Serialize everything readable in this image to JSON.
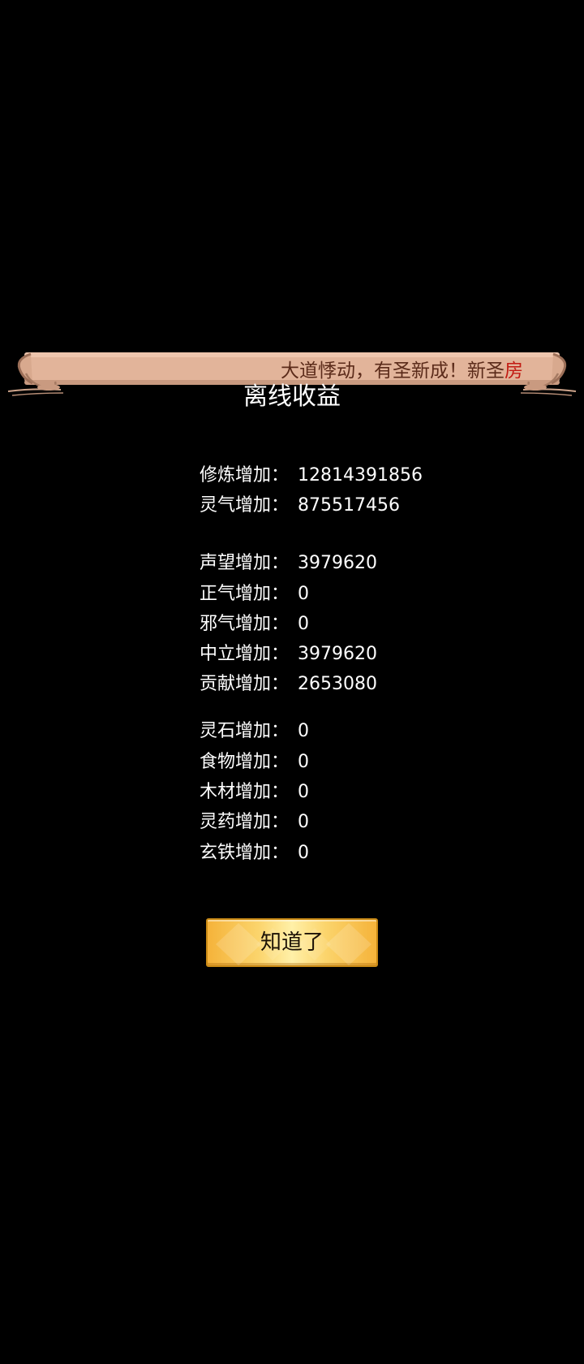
{
  "banner": {
    "scroll_text": "大道悸动，有圣新成！新圣",
    "scroll_text_highlight": "房"
  },
  "popup": {
    "title": "离线收益",
    "cultivation_group": [
      {
        "label": "修炼增加：",
        "value": "12814391856"
      },
      {
        "label": "灵气增加：",
        "value": "875517456"
      }
    ],
    "reputation_group": [
      {
        "label": "声望增加：",
        "value": "3979620"
      },
      {
        "label": "正气增加：",
        "value": "0"
      },
      {
        "label": "邪气增加：",
        "value": "0"
      },
      {
        "label": "中立增加：",
        "value": "3979620"
      },
      {
        "label": "贡献增加：",
        "value": "2653080"
      }
    ],
    "resource_group": [
      {
        "label": "灵石增加：",
        "value": "0"
      },
      {
        "label": "食物增加：",
        "value": "0"
      },
      {
        "label": "木材增加：",
        "value": "0"
      },
      {
        "label": "灵药增加：",
        "value": "0"
      },
      {
        "label": "玄铁增加：",
        "value": "0"
      }
    ],
    "confirm_label": "知道了"
  },
  "colors": {
    "background": "#000000",
    "scroll_paper": "#e2b49a",
    "scroll_text": "#5b2b1a",
    "scroll_highlight": "#c21a12",
    "button_gold": "#fbd46c"
  }
}
